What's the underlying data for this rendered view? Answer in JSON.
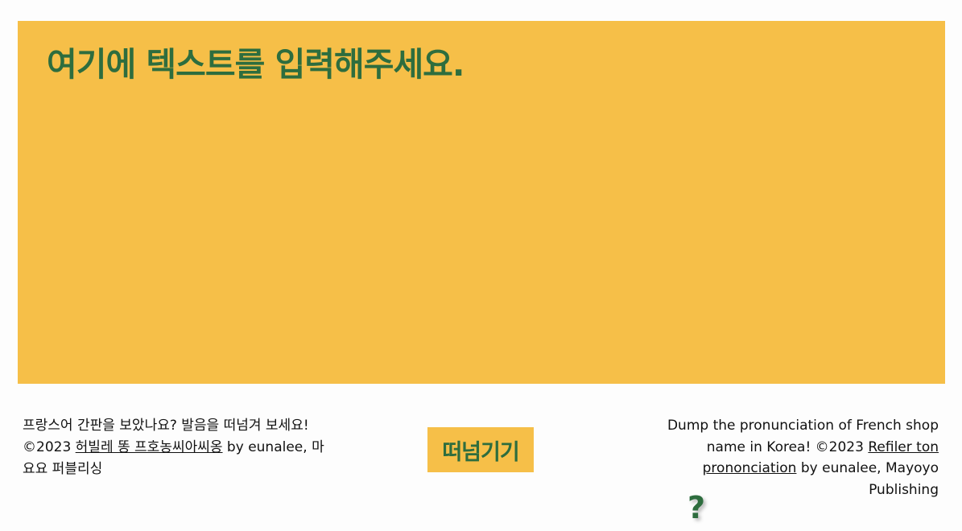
{
  "main": {
    "placeholder": "여기에 텍스트를 입력해주세요."
  },
  "footer_left": {
    "line1": "프랑스어 간판을 보았나요? 발음을 떠넘겨 보세요!",
    "copyright_prefix": "©2023 ",
    "link_label": "허빌레 똥 프호농씨아씨옹",
    "suffix": " by eunalee, 마요요 퍼블리싱"
  },
  "dump_button": {
    "label": "떠넘기기"
  },
  "footer_right": {
    "intro": "Dump the pronunciation of French shop name in Korea! ©2023 ",
    "link_label": "Refiler ton prononciation",
    "suffix": " by eunalee, Mayoyo Publishing"
  },
  "help": {
    "glyph": "?"
  },
  "colors": {
    "accent_yellow": "#f6bf48",
    "accent_green": "#2e6d3e"
  }
}
